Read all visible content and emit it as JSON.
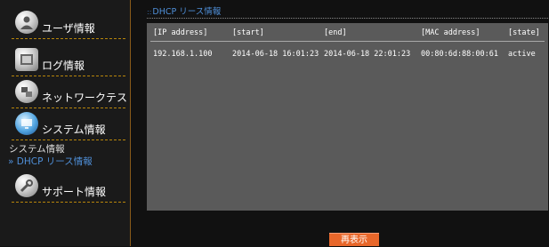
{
  "sidebar": {
    "items": [
      {
        "label": "ユーザ情報",
        "icon": "user-icon"
      },
      {
        "label": "ログ情報",
        "icon": "log-icon"
      },
      {
        "label": "ネットワークテスト",
        "icon": "network-test-icon"
      },
      {
        "label": "システム情報",
        "icon": "system-icon"
      },
      {
        "label": "サポート情報",
        "icon": "support-icon"
      }
    ],
    "subitems": {
      "system_info": "システム情報",
      "dhcp_lease": "DHCP リース情報"
    }
  },
  "main": {
    "section_title": "DHCP リース情報",
    "section_mark": "::",
    "table": {
      "headers": [
        "[IP address]",
        "[start]",
        "[end]",
        "[MAC address]",
        "[state]"
      ],
      "rows": [
        [
          "192.168.1.100",
          "2014-06-18 16:01:23",
          "2014-06-18 22:01:23",
          "00:80:6d:88:00:61",
          "active"
        ]
      ]
    },
    "refresh_label": "再表示"
  },
  "colors": {
    "accent_blue": "#4f8fd8",
    "panel_gray": "#5a5a5a",
    "button_orange": "#e8672a",
    "divider_gold": "#b8860b"
  }
}
